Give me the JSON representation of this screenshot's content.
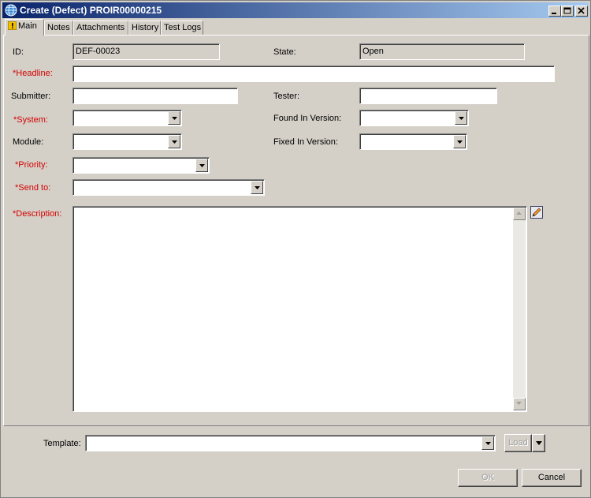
{
  "window": {
    "title": "Create (Defect) PROIR00000215"
  },
  "tabs": [
    {
      "label": "Main"
    },
    {
      "label": "Notes"
    },
    {
      "label": "Attachments"
    },
    {
      "label": "History"
    },
    {
      "label": "Test Logs"
    }
  ],
  "form": {
    "id_label": "ID:",
    "id_value": "DEF-00023",
    "state_label": "State:",
    "state_value": "Open",
    "headline_label": "*Headline:",
    "submitter_label": "Submitter:",
    "tester_label": "Tester:",
    "system_label": "*System:",
    "found_in_version_label": "Found In Version:",
    "module_label": "Module:",
    "fixed_in_version_label": "Fixed In Version:",
    "priority_label": "*Priority:",
    "send_to_label": "*Send to:",
    "description_label": "*Description:"
  },
  "footer": {
    "template_label": "Template:",
    "load_label": "Load",
    "ok_label": "OK",
    "cancel_label": "Cancel"
  },
  "colors": {
    "required_label": "#d40000",
    "titlebar_start": "#0a246a",
    "titlebar_end": "#a6caf0",
    "face": "#d4d0c8"
  }
}
